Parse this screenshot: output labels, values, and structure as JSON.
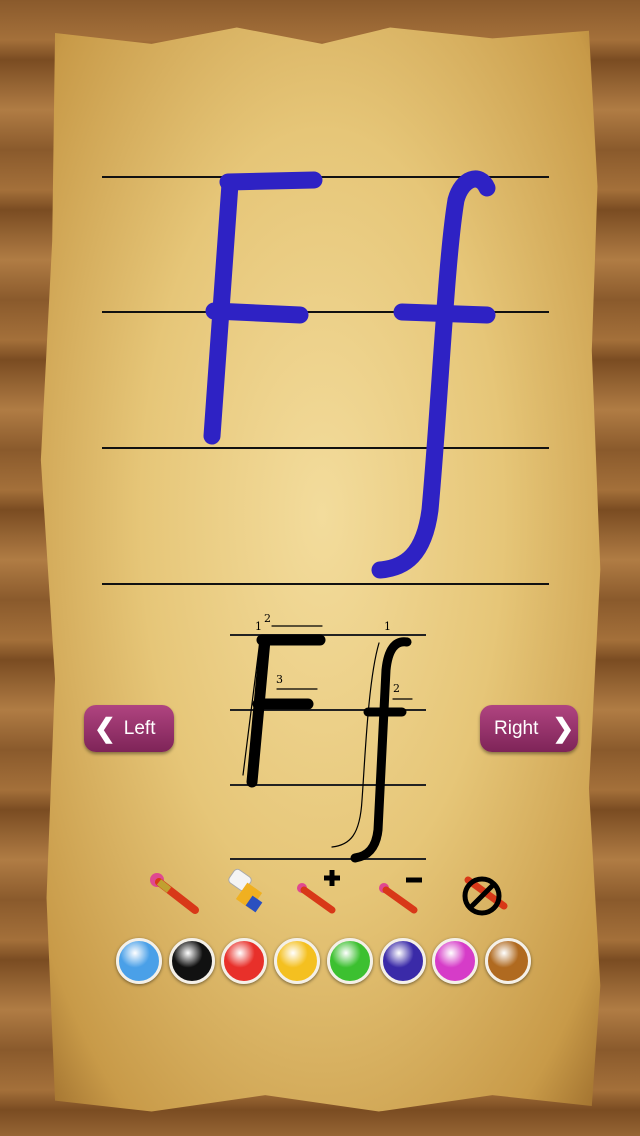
{
  "letter": {
    "upper": "F",
    "lower": "f",
    "stroke_color": "#2e22c4"
  },
  "guide": {
    "numbers": [
      "1",
      "2",
      "3",
      "1",
      "2"
    ]
  },
  "nav": {
    "left_label": "Left",
    "right_label": "Right",
    "left_icon": "chevron-left-icon",
    "right_icon": "chevron-right-icon"
  },
  "tools": [
    {
      "name": "brush",
      "icon": "paintbrush-icon"
    },
    {
      "name": "eraser",
      "icon": "eraser-icon"
    },
    {
      "name": "brush-size-increase",
      "icon": "paintbrush-plus-icon",
      "sign": "+"
    },
    {
      "name": "brush-size-decrease",
      "icon": "paintbrush-minus-icon",
      "sign": "−"
    },
    {
      "name": "clear",
      "icon": "no-brush-icon"
    }
  ],
  "colors": [
    "#4aa0e8",
    "#111111",
    "#e8302a",
    "#f4c020",
    "#3cc030",
    "#3a2aa8",
    "#d63cc8",
    "#b06a20"
  ]
}
